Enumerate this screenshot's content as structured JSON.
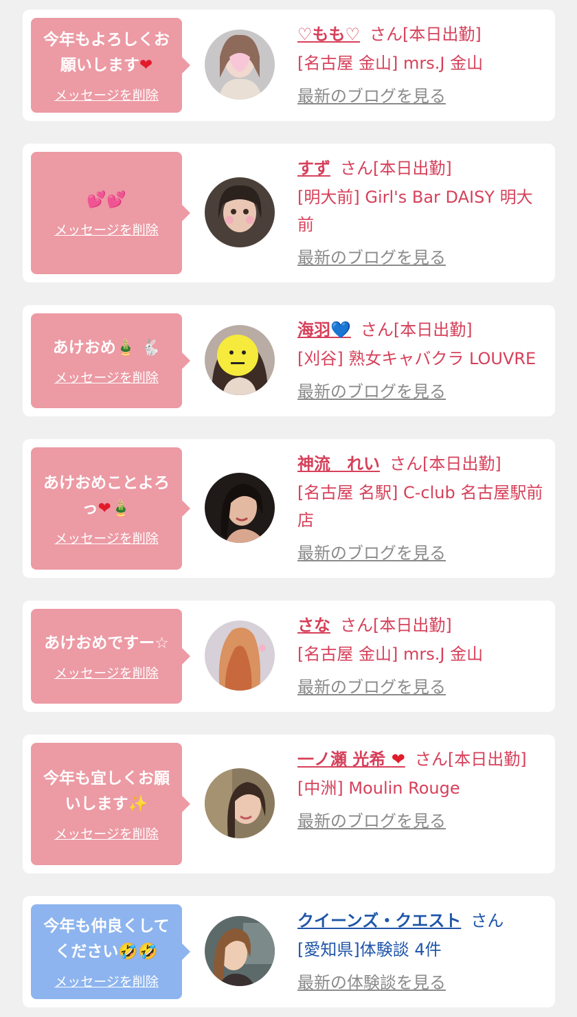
{
  "items": [
    {
      "message": "今年もよろしくお願いします",
      "message_emoji": "❤",
      "delete_label": "メッセージを削除",
      "name": "♡もも♡",
      "name_emoji": "",
      "honorific": "さん[本日出勤]",
      "shop": "[名古屋 金山] mrs.J 金山",
      "blog_link": "最新のブログを見る"
    },
    {
      "message": "",
      "message_emoji": "💕💕",
      "delete_label": "メッセージを削除",
      "name": "すず",
      "name_emoji": "",
      "honorific": "さん[本日出勤]",
      "shop": "[明大前] Girl's Bar DAISY 明大前",
      "blog_link": "最新のブログを見る"
    },
    {
      "message": "あけおめ",
      "message_emoji": "🎍 🐇",
      "delete_label": "メッセージを削除",
      "name": "海羽",
      "name_emoji": "💙",
      "honorific": "さん[本日出勤]",
      "shop": "[刈谷] 熟女キャバクラ LOUVRE",
      "blog_link": "最新のブログを見る"
    },
    {
      "message": "あけおめことよろっ",
      "message_emoji": "❤🎍",
      "delete_label": "メッセージを削除",
      "name": "神流　れい",
      "name_emoji": "",
      "honorific": "さん[本日出勤]",
      "shop": "[名古屋 名駅] C-club 名古屋駅前店",
      "blog_link": "最新のブログを見る"
    },
    {
      "message": "あけおめですー☆",
      "message_emoji": "",
      "delete_label": "メッセージを削除",
      "name": "さな",
      "name_emoji": "",
      "honorific": "さん[本日出勤]",
      "shop": "[名古屋 金山] mrs.J 金山",
      "blog_link": "最新のブログを見る"
    },
    {
      "message": "今年も宜しくお願いします",
      "message_emoji": "✨",
      "delete_label": "メッセージを削除",
      "name": "一ノ瀬 光希 ",
      "name_emoji": "❤",
      "honorific": "さん[本日出勤]",
      "shop": "[中洲] Moulin Rouge",
      "blog_link": "最新のブログを見る"
    },
    {
      "message": "今年も仲良くしてください",
      "message_emoji": "🤣🤣",
      "delete_label": "メッセージを削除",
      "name": "クイーンズ・クエスト",
      "name_emoji": "",
      "honorific": "さん",
      "shop": "[愛知県]体験談 4件",
      "blog_link": "最新の体験談を見る"
    }
  ],
  "colors": {
    "background": "#f0f0f0",
    "pink_bubble": "#ec9aa4",
    "blue_bubble": "#8db4ee",
    "pink_text": "#d6405a",
    "blue_text": "#1f55a8",
    "link_grey": "#8a8a8a"
  }
}
